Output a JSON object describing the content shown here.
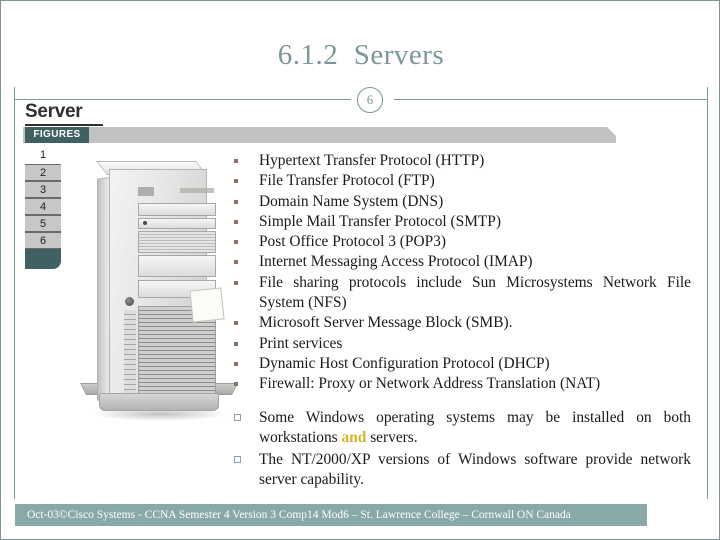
{
  "slide": {
    "title": "6.1.2  Servers",
    "slide_number": "6",
    "accent_color": "#7e9699",
    "footer_bar_color": "#89a8a8",
    "highlight_color": "#d9b227",
    "bullet_color": "#8a7168"
  },
  "figures_panel": {
    "wordmark": "Server",
    "tab_label": "FIGURES",
    "numbers": [
      "1",
      "2",
      "3",
      "4",
      "5",
      "6"
    ],
    "active_number": "1"
  },
  "content": {
    "protocol_bullets": [
      "Hypertext Transfer Protocol (HTTP)",
      "File Transfer Protocol (FTP)",
      "Domain Name System (DNS)",
      "Simple Mail Transfer Protocol (SMTP)",
      "Post Office Protocol 3 (POP3)",
      "Internet Messaging Access Protocol (IMAP)",
      "File sharing protocols include Sun Microsystems Network File System (NFS)",
      "Microsoft Server Message Block (SMB).",
      "Print services",
      "Dynamic Host Configuration Protocol (DHCP)",
      "Firewall: Proxy or Network Address Translation (NAT)"
    ],
    "notes": {
      "note1_part1": "Some Windows operating systems may be installed on both workstations ",
      "note1_highlight": "and",
      "note1_part2": " servers.",
      "note2": "The NT/2000/XP versions of Windows software provide network server capability."
    }
  },
  "footer": {
    "text": "Oct-03©Cisco Systems - CCNA Semester 4 Version 3 Comp14 Mod6 – St. Lawrence College – Cornwall ON Canada"
  }
}
